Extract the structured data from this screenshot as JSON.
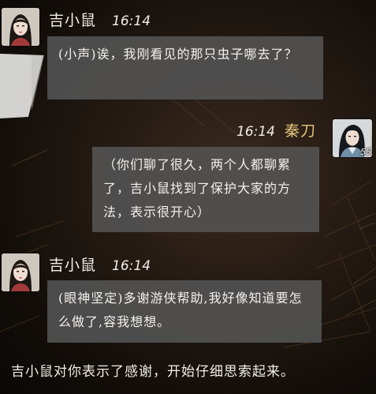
{
  "messages": [
    {
      "speaker": "吉小鼠",
      "time": "16:14",
      "text": "(小声)诶，我刚看见的那只虫子哪去了？",
      "avatar_icon": "female-character-portrait-icon"
    },
    {
      "speaker": "秦刀",
      "time": "16:14",
      "text": "（你们聊了很久，两个人都聊累了，吉小鼠找到了保护大家的方法，表示很开心）",
      "avatar_icon": "male-swordsman-portrait-icon",
      "level": "55"
    },
    {
      "speaker": "吉小鼠",
      "time": "16:14",
      "text": "(眼神坚定)多谢游侠帮助,我好像知道要怎么做了,容我想想。",
      "avatar_icon": "female-character-portrait-icon"
    }
  ],
  "narration": "吉小鼠对你表示了感谢，开始仔细思索起来。",
  "colors": {
    "bubble_bg": "#535353",
    "player_name": "#e4c57c",
    "text": "#f1eee8"
  }
}
